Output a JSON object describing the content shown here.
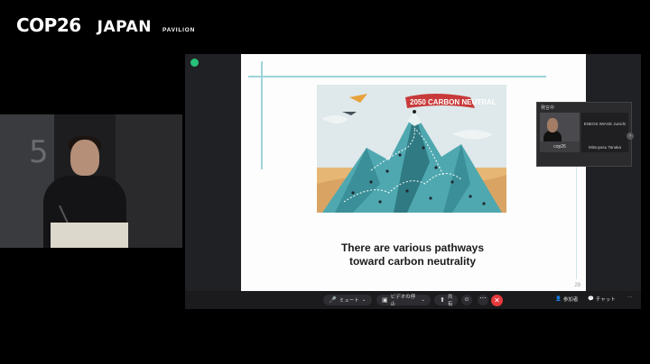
{
  "brand": {
    "cop": "COP26",
    "japan": "JAPAN",
    "pavilion": "PAVILION"
  },
  "speaker": {
    "wall_number": "5"
  },
  "slide": {
    "banner": "2050 CARBON NEUTRAL",
    "caption_line1": "There are various pathways",
    "caption_line2": "toward carbon neutrality",
    "page_number": "29"
  },
  "gallery": {
    "header": "発言中",
    "tile1_name": "cop26",
    "tile2_title": "ENEOS IWASE Junichi",
    "tile2_name": "Mitsuyasu Tanaka"
  },
  "toolbar": {
    "mute": "ミュート",
    "video": "ビデオの停止",
    "share": "共有",
    "participants": "参加者",
    "chat": "チャット"
  },
  "icons": {
    "mic": "microphone-icon",
    "cam": "camera-icon",
    "share": "share-screen-icon",
    "end": "end-call-icon"
  },
  "colors": {
    "end_red": "#e5393d",
    "accent_teal": "#9fd3d8",
    "shield_green": "#27c07a"
  }
}
